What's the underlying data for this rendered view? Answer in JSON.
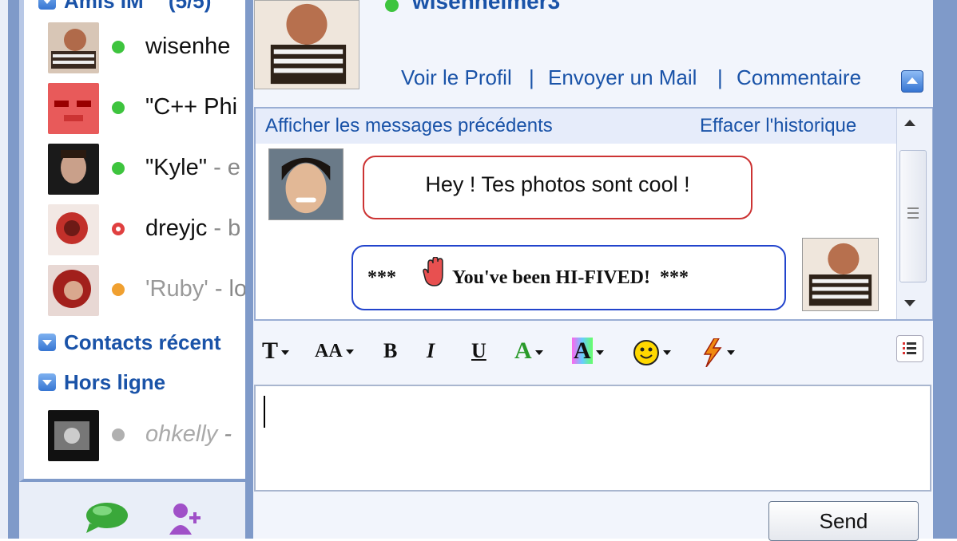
{
  "contacts_panel": {
    "group_online_label": "Amis IM",
    "group_online_count": "(5/5)",
    "contacts": [
      {
        "name": "wisenhe",
        "sub": "",
        "status": "online"
      },
      {
        "name": "\"C++ Phi",
        "sub": "",
        "status": "online"
      },
      {
        "name": "\"Kyle\"",
        "sub": " - e",
        "status": "online"
      },
      {
        "name": "dreyjc",
        "sub": " - b",
        "status": "busy"
      },
      {
        "name": "'Ruby'",
        "sub": " - lo",
        "status": "idle"
      }
    ],
    "group_recent_label": "Contacts récent",
    "group_offline_label": "Hors ligne",
    "offline_contact": {
      "name": "ohkelly",
      "sub": " -",
      "status": "offline"
    }
  },
  "chat": {
    "contact_name": "wisenheimer3",
    "links": {
      "profile": "Voir le Profil",
      "mail": "Envoyer un Mail",
      "comment": "Commentaire",
      "separator": "|"
    },
    "history_link": "Afficher les messages précédents",
    "clear_link": "Effacer l'historique",
    "messages": [
      {
        "from": "friend",
        "text": "Hey ! Tes photos sont cool !"
      },
      {
        "from": "me",
        "prefix": "***",
        "text": "You've been HI-FIVED!",
        "suffix": "***"
      }
    ],
    "toolbar": {
      "font": "T",
      "size": "AA",
      "bold": "B",
      "italic": "I",
      "underline": "U",
      "text_color": "A",
      "bg_color": "A"
    },
    "input_value": "",
    "send_label": "Send"
  },
  "colors": {
    "online": "#3ec43e",
    "busy": "#e04040",
    "idle": "#f0a030",
    "offline": "#b0b0b0",
    "link": "#1a53a8"
  }
}
